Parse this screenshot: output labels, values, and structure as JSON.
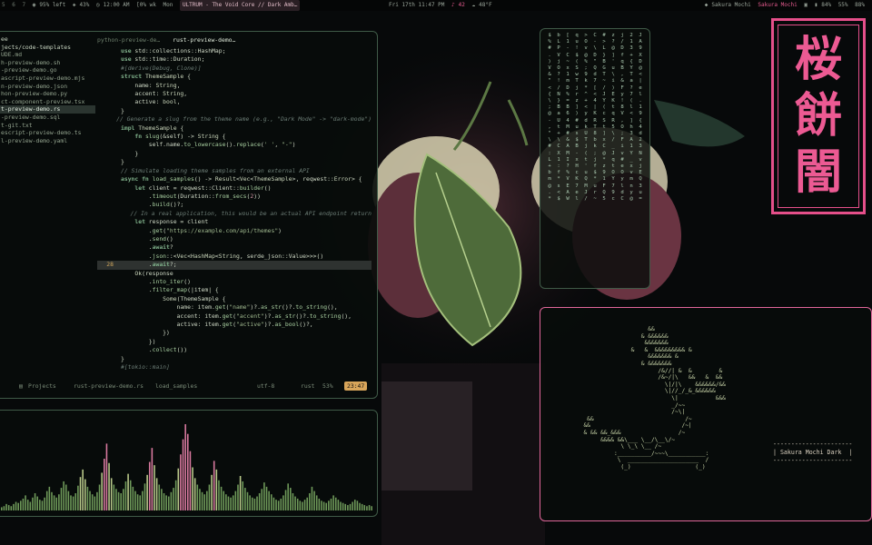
{
  "topbar": {
    "workspaces": [
      "5",
      "6",
      "7"
    ],
    "battery_left": "95% left",
    "cpu": "43%",
    "time_left": "12:00 AM",
    "week": "[0% wk",
    "day": "Mon",
    "window_title": "ULTRUM - The Void Core // Dark Amb…",
    "datetime": "Fri 17th 11:47 PM",
    "vol": "42",
    "weather": "48°F",
    "user1": "Sakura Mochi",
    "user2": "Sakura Mochi",
    "bat_pct": "84%",
    "mem_pct": "55%",
    "disk_pct": "88%"
  },
  "editor": {
    "tabs": [
      "python-preview-de…",
      "rust-preview-demo…"
    ],
    "tree": [
      "ee",
      "jects/code-templates",
      "UDE.md",
      "h-preview-demo.sh",
      "-preview-demo.go",
      "ascript-preview-demo.mjs",
      "n-preview-demo.json",
      "hon-preview-demo.py",
      "ct-component-preview.tsx",
      "t-preview-demo.rs",
      "-preview-demo.sql",
      "t-git.txt",
      "escript-preview-demo.ts",
      "l-preview-demo.yaml"
    ],
    "selected_index": 9,
    "current_line": 28,
    "status": {
      "projects": "Projects",
      "file": "rust-preview-demo.rs",
      "fn": "load_samples",
      "enc": "utf-8",
      "lang": "rust",
      "pct": "53%",
      "clock": "23:47"
    }
  },
  "code_lines": [
    {
      "n": "",
      "h": "<span class=\"k\">use</span> std::collections::HashMap;"
    },
    {
      "n": "",
      "h": "<span class=\"k\">use</span> std::time::Duration;"
    },
    {
      "n": "",
      "h": ""
    },
    {
      "n": "",
      "h": "<span class=\"c\">#[derive(Debug, Clone)]</span>"
    },
    {
      "n": "",
      "h": "<span class=\"k\">struct</span> <span class=\"t\">ThemeSample</span> {"
    },
    {
      "n": "",
      "h": "    name: <span class=\"t\">String</span>,"
    },
    {
      "n": "",
      "h": "    accent: <span class=\"t\">String</span>,"
    },
    {
      "n": "",
      "h": "    active: <span class=\"t\">bool</span>,"
    },
    {
      "n": "",
      "h": "}"
    },
    {
      "n": "",
      "h": "<span class=\"c\">// Generate a slug from the theme name (e.g., \"Dark Mode\" -> \"dark-mode\")</span>"
    },
    {
      "n": "",
      "h": "<span class=\"k\">impl</span> <span class=\"t\">ThemeSample</span> {"
    },
    {
      "n": "",
      "h": "    <span class=\"k\">fn</span> <span class=\"f\">slug</span>(&amp;self) -> <span class=\"t\">String</span> {"
    },
    {
      "n": "",
      "h": "        self.name.<span class=\"f\">to_lowercase</span>().<span class=\"f\">replace</span>(<span class=\"s\">' '</span>, <span class=\"s\">\"-\"</span>)"
    },
    {
      "n": "",
      "h": "    }"
    },
    {
      "n": "",
      "h": "}"
    },
    {
      "n": "",
      "h": ""
    },
    {
      "n": "",
      "h": "<span class=\"c\">// Simulate loading theme samples from an external API</span>"
    },
    {
      "n": "",
      "h": "<span class=\"k\">async fn</span> <span class=\"f\">load_samples</span>() -> <span class=\"t\">Result</span>&lt;<span class=\"t\">Vec</span>&lt;<span class=\"t\">ThemeSample</span>&gt;, reqwest::<span class=\"t\">Error</span>&gt; {"
    },
    {
      "n": "",
      "h": "    <span class=\"k\">let</span> client = reqwest::Client::<span class=\"f\">builder</span>()"
    },
    {
      "n": "",
      "h": "        .<span class=\"f\">timeout</span>(Duration::<span class=\"f\">from_secs</span>(<span class=\"m\">2</span>))"
    },
    {
      "n": "",
      "h": "        .<span class=\"f\">build</span>()?;"
    },
    {
      "n": "",
      "h": "    <span class=\"c\">// In a real application, this would be an actual API endpoint return</span>"
    },
    {
      "n": "",
      "h": "    <span class=\"k\">let</span> response = client"
    },
    {
      "n": "",
      "h": "        .<span class=\"f\">get</span>(<span class=\"s\">\"https://example.com/api/themes\"</span>)"
    },
    {
      "n": "",
      "h": "        .<span class=\"f\">send</span>()"
    },
    {
      "n": "",
      "h": "        .<span class=\"k\">await</span>?"
    },
    {
      "n": "",
      "h": "        .<span class=\"f\">json</span>::&lt;<span class=\"t\">Vec</span>&lt;<span class=\"t\">HashMap</span>&lt;<span class=\"t\">String</span>, serde_json::Value&gt;&gt;&gt;()"
    },
    {
      "n": "28",
      "h": "        .<span class=\"k\">await</span>?;"
    },
    {
      "n": "",
      "h": ""
    },
    {
      "n": "",
      "h": "    <span class=\"t\">Ok</span>(response"
    },
    {
      "n": "",
      "h": "        .<span class=\"f\">into_iter</span>()"
    },
    {
      "n": "",
      "h": "        .<span class=\"f\">filter_map</span>(|item| {"
    },
    {
      "n": "",
      "h": "            <span class=\"t\">Some</span>(ThemeSample {"
    },
    {
      "n": "",
      "h": "                name: item.<span class=\"f\">get</span>(<span class=\"s\">\"name\"</span>)?.<span class=\"f\">as_str</span>()?.<span class=\"f\">to_string</span>(),"
    },
    {
      "n": "",
      "h": "                accent: item.<span class=\"f\">get</span>(<span class=\"s\">\"accent\"</span>)?.<span class=\"f\">as_str</span>()?.<span class=\"f\">to_string</span>(),"
    },
    {
      "n": "",
      "h": "                active: item.<span class=\"f\">get</span>(<span class=\"s\">\"active\"</span>)?.<span class=\"f\">as_bool</span>()?,"
    },
    {
      "n": "",
      "h": "            })"
    },
    {
      "n": "",
      "h": "        })"
    },
    {
      "n": "",
      "h": "        .<span class=\"f\">collect</span>())"
    },
    {
      "n": "",
      "h": "}"
    },
    {
      "n": "",
      "h": ""
    },
    {
      "n": "",
      "h": "<span class=\"c\">#[tokio::main]</span>"
    }
  ],
  "spectrum": [
    3,
    4,
    6,
    5,
    4,
    6,
    8,
    7,
    9,
    11,
    14,
    10,
    8,
    12,
    16,
    13,
    10,
    9,
    12,
    18,
    22,
    17,
    14,
    12,
    15,
    21,
    27,
    24,
    18,
    14,
    13,
    16,
    23,
    31,
    38,
    29,
    22,
    18,
    15,
    13,
    17,
    24,
    35,
    48,
    62,
    44,
    30,
    24,
    20,
    17,
    16,
    20,
    27,
    34,
    28,
    22,
    18,
    15,
    14,
    18,
    25,
    33,
    45,
    58,
    42,
    30,
    24,
    20,
    16,
    14,
    13,
    17,
    21,
    28,
    39,
    52,
    66,
    80,
    71,
    55,
    40,
    30,
    24,
    20,
    17,
    15,
    18,
    24,
    33,
    46,
    38,
    28,
    22,
    18,
    15,
    13,
    12,
    14,
    18,
    24,
    32,
    27,
    21,
    17,
    14,
    12,
    11,
    13,
    16,
    20,
    26,
    22,
    18,
    15,
    12,
    10,
    9,
    11,
    14,
    19,
    25,
    21,
    16,
    13,
    11,
    9,
    8,
    10,
    12,
    16,
    22,
    18,
    14,
    11,
    9,
    8,
    7,
    9,
    11,
    14,
    12,
    10,
    8,
    7,
    6,
    5,
    6,
    8,
    10,
    9,
    7,
    6,
    5,
    4,
    5,
    4
  ],
  "matrix_cols": [
    "$\n%\n#\n.\n)\nV\n&\n\"\n<\n{\n\\\n;\n@\n-\n,\n\"\n\\\n#\n:\nL\n+\nb\nm\n@\n.\n*",
    "b\nL\nP\nV\nj\nO\n?\n!\n/\nN\n}\nB\na\nU\nt\n+\n\\\nC\nX\n1\n:\nf\n*\ns\n<\n$",
    "[\n1\n-\nC\n~\nx\n1\nm\nD\n%\n=\nB\n6\n4\nM\n#\n&\nA\nM\nI\n?\n%\nV\nE\nA\nW",
    "q\nu\n!\n$\n(\nS\nw\nT\nj\nr\nz\n]\n)\n#\nu\ns\n$\nB\n-\nx\nH\nc\nK\n7\ne\nl",
    ">\nO\nv\n@\n%\n;\n9\nk\n*\n^\n+\n<\ny\nd\nk\nU\nT\nj\n(\nt\n'\nu\nQ\nM\nJ\n/",
    "C\n-\n\\\nD\n\"\nQ\nd\n7\n[\n<\n4\n|\nK\nR\nT\n8\nb\nk\n;\nj\nf\n$\n*\nu\nr\n~",
    "#\n>\nL\n}\nB\nG\nT\n~\n/\nJ\nY\n(\nc\nS\nt\n]\nx\nC\n@\n*\nz\n9\n1\nF\nQ\n5",
    "z\n?\n@\n]\n'\nu\n\\\ni\n)\nE\nK\nt\nq\nR\n5\n\\\n/\n_\nJ\nq\nt\nO\nY\n7\n9\nc",
    "j\n/\nD\nf\nq\nB\n,\n&\nF\ny\n!\n8\nV\n,\nO\n;\nF\ni\nv\n#\ne\nO\ny\nl\nd\nC",
    "2\n1\n3\n+\n{\nY\nT\na\n?\n7\n(\nl\n<\n]\nh\n3\nA\n1\nY\n_\nx\nv\nm\nn\ny\n@",
    "J\nA\n9\nX\nD\n@\n<\n|\ne\nl\n.\n1\n9\n{\n4\nd\n2\n3\nN\nv\nj\nE\nQ\n3\nu\n="
  ],
  "sakura_chars": [
    "桜",
    "餅",
    "闇"
  ],
  "ascii_art": "                     &&\n                   & &&&&&&\n                    &&&&&&&\n                &   &  &&&&&&&&& &\n                     &&&&&&& &\n                   & &&&&&&&\n                        /&//| &  &        &\n                        /&~/|\\   &&   &  &&\n                          \\|/|\\    &&&&&&/&&\n                          \\|//_/_&_&&&&&&\n                            \\|           &&&\n                            _/~~\n                            /~\\|\n   &&                           /~\n  &&                           /~|\n  & && &&_&&&                 /~\n       &&&& &&\\___ \\__/\\__\\/~\n             \\ \\_\\ \\__ /~\n           :__________/~~~\\___________:\n            \\  _____________________  /\n             (_)                   (_)",
  "theme_box": "----------------------\n| Sakura Mochi Dark  |\n----------------------"
}
